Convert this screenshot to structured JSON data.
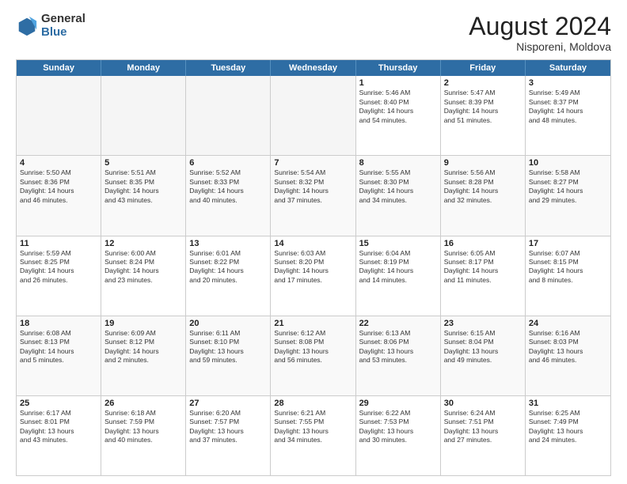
{
  "logo": {
    "general": "General",
    "blue": "Blue"
  },
  "title": {
    "month_year": "August 2024",
    "location": "Nisporeni, Moldova"
  },
  "header_days": [
    "Sunday",
    "Monday",
    "Tuesday",
    "Wednesday",
    "Thursday",
    "Friday",
    "Saturday"
  ],
  "rows": [
    [
      {
        "day": "",
        "info": "",
        "empty": true
      },
      {
        "day": "",
        "info": "",
        "empty": true
      },
      {
        "day": "",
        "info": "",
        "empty": true
      },
      {
        "day": "",
        "info": "",
        "empty": true
      },
      {
        "day": "1",
        "info": "Sunrise: 5:46 AM\nSunset: 8:40 PM\nDaylight: 14 hours\nand 54 minutes."
      },
      {
        "day": "2",
        "info": "Sunrise: 5:47 AM\nSunset: 8:39 PM\nDaylight: 14 hours\nand 51 minutes."
      },
      {
        "day": "3",
        "info": "Sunrise: 5:49 AM\nSunset: 8:37 PM\nDaylight: 14 hours\nand 48 minutes."
      }
    ],
    [
      {
        "day": "4",
        "info": "Sunrise: 5:50 AM\nSunset: 8:36 PM\nDaylight: 14 hours\nand 46 minutes."
      },
      {
        "day": "5",
        "info": "Sunrise: 5:51 AM\nSunset: 8:35 PM\nDaylight: 14 hours\nand 43 minutes."
      },
      {
        "day": "6",
        "info": "Sunrise: 5:52 AM\nSunset: 8:33 PM\nDaylight: 14 hours\nand 40 minutes."
      },
      {
        "day": "7",
        "info": "Sunrise: 5:54 AM\nSunset: 8:32 PM\nDaylight: 14 hours\nand 37 minutes."
      },
      {
        "day": "8",
        "info": "Sunrise: 5:55 AM\nSunset: 8:30 PM\nDaylight: 14 hours\nand 34 minutes."
      },
      {
        "day": "9",
        "info": "Sunrise: 5:56 AM\nSunset: 8:28 PM\nDaylight: 14 hours\nand 32 minutes."
      },
      {
        "day": "10",
        "info": "Sunrise: 5:58 AM\nSunset: 8:27 PM\nDaylight: 14 hours\nand 29 minutes."
      }
    ],
    [
      {
        "day": "11",
        "info": "Sunrise: 5:59 AM\nSunset: 8:25 PM\nDaylight: 14 hours\nand 26 minutes."
      },
      {
        "day": "12",
        "info": "Sunrise: 6:00 AM\nSunset: 8:24 PM\nDaylight: 14 hours\nand 23 minutes."
      },
      {
        "day": "13",
        "info": "Sunrise: 6:01 AM\nSunset: 8:22 PM\nDaylight: 14 hours\nand 20 minutes."
      },
      {
        "day": "14",
        "info": "Sunrise: 6:03 AM\nSunset: 8:20 PM\nDaylight: 14 hours\nand 17 minutes."
      },
      {
        "day": "15",
        "info": "Sunrise: 6:04 AM\nSunset: 8:19 PM\nDaylight: 14 hours\nand 14 minutes."
      },
      {
        "day": "16",
        "info": "Sunrise: 6:05 AM\nSunset: 8:17 PM\nDaylight: 14 hours\nand 11 minutes."
      },
      {
        "day": "17",
        "info": "Sunrise: 6:07 AM\nSunset: 8:15 PM\nDaylight: 14 hours\nand 8 minutes."
      }
    ],
    [
      {
        "day": "18",
        "info": "Sunrise: 6:08 AM\nSunset: 8:13 PM\nDaylight: 14 hours\nand 5 minutes."
      },
      {
        "day": "19",
        "info": "Sunrise: 6:09 AM\nSunset: 8:12 PM\nDaylight: 14 hours\nand 2 minutes."
      },
      {
        "day": "20",
        "info": "Sunrise: 6:11 AM\nSunset: 8:10 PM\nDaylight: 13 hours\nand 59 minutes."
      },
      {
        "day": "21",
        "info": "Sunrise: 6:12 AM\nSunset: 8:08 PM\nDaylight: 13 hours\nand 56 minutes."
      },
      {
        "day": "22",
        "info": "Sunrise: 6:13 AM\nSunset: 8:06 PM\nDaylight: 13 hours\nand 53 minutes."
      },
      {
        "day": "23",
        "info": "Sunrise: 6:15 AM\nSunset: 8:04 PM\nDaylight: 13 hours\nand 49 minutes."
      },
      {
        "day": "24",
        "info": "Sunrise: 6:16 AM\nSunset: 8:03 PM\nDaylight: 13 hours\nand 46 minutes."
      }
    ],
    [
      {
        "day": "25",
        "info": "Sunrise: 6:17 AM\nSunset: 8:01 PM\nDaylight: 13 hours\nand 43 minutes."
      },
      {
        "day": "26",
        "info": "Sunrise: 6:18 AM\nSunset: 7:59 PM\nDaylight: 13 hours\nand 40 minutes."
      },
      {
        "day": "27",
        "info": "Sunrise: 6:20 AM\nSunset: 7:57 PM\nDaylight: 13 hours\nand 37 minutes."
      },
      {
        "day": "28",
        "info": "Sunrise: 6:21 AM\nSunset: 7:55 PM\nDaylight: 13 hours\nand 34 minutes."
      },
      {
        "day": "29",
        "info": "Sunrise: 6:22 AM\nSunset: 7:53 PM\nDaylight: 13 hours\nand 30 minutes."
      },
      {
        "day": "30",
        "info": "Sunrise: 6:24 AM\nSunset: 7:51 PM\nDaylight: 13 hours\nand 27 minutes."
      },
      {
        "day": "31",
        "info": "Sunrise: 6:25 AM\nSunset: 7:49 PM\nDaylight: 13 hours\nand 24 minutes."
      }
    ]
  ]
}
